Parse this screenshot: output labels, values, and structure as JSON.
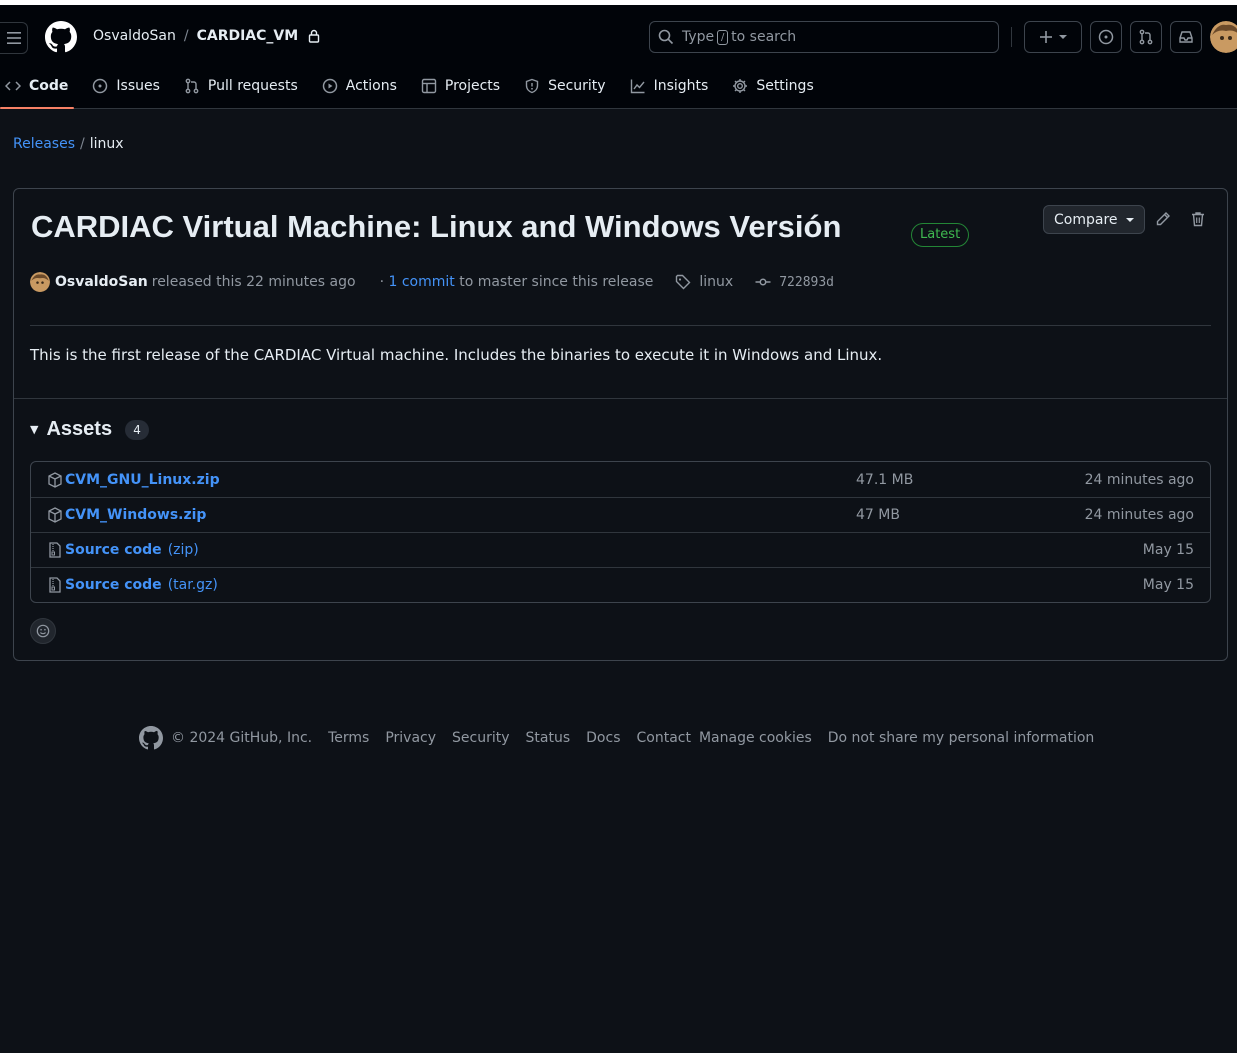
{
  "header": {
    "owner": "OsvaldoSan",
    "separator": "/",
    "repo": "CARDIAC_VM",
    "search_prefix": "Type",
    "search_key": "/",
    "search_suffix": "to search"
  },
  "nav": {
    "code": "Code",
    "issues": "Issues",
    "pulls": "Pull requests",
    "actions": "Actions",
    "projects": "Projects",
    "security": "Security",
    "insights": "Insights",
    "settings": "Settings"
  },
  "breadcrumb": {
    "releases": "Releases",
    "separator": "/",
    "current": "linux"
  },
  "release": {
    "title": "CARDIAC Virtual Machine: Linux and Windows Versión",
    "badge": "Latest",
    "compare": "Compare",
    "author": "OsvaldoSan",
    "released_text": "released this 22 minutes ago",
    "commits_prefix": "·",
    "commits_link": "1 commit",
    "commits_suffix": "to master since this release",
    "tag": "linux",
    "sha": "722893d",
    "body": "This is the first release of the CARDIAC Virtual machine. Includes the binaries to execute it in Windows and Linux."
  },
  "assets": {
    "title": "Assets",
    "count": "4",
    "items": [
      {
        "name": "CVM_GNU_Linux.zip",
        "suffix": "",
        "size": "47.1 MB",
        "date": "24 minutes ago"
      },
      {
        "name": "CVM_Windows.zip",
        "suffix": "",
        "size": "47 MB",
        "date": "24 minutes ago"
      },
      {
        "name": "Source code",
        "suffix": "(zip)",
        "size": "",
        "date": "May 15"
      },
      {
        "name": "Source code",
        "suffix": "(tar.gz)",
        "size": "",
        "date": "May 15"
      }
    ]
  },
  "footer": {
    "copyright": "© 2024 GitHub, Inc.",
    "terms": "Terms",
    "privacy": "Privacy",
    "security": "Security",
    "status": "Status",
    "docs": "Docs",
    "contact": "Contact",
    "cookies": "Manage cookies",
    "do_not_share": "Do not share my personal information"
  },
  "colors": {
    "background": "#0d1117",
    "header": "#010409",
    "link": "#4493f8",
    "latest_green": "#3fb950",
    "active_tab": "#f78166"
  }
}
